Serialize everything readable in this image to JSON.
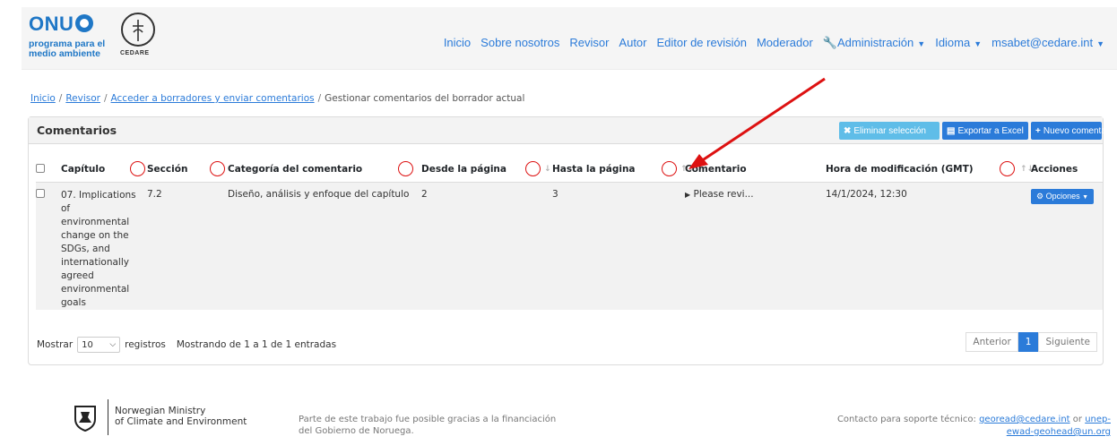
{
  "brand": {
    "onu": "ONU",
    "onu_sub": "programa para el medio ambiente",
    "cedare": "CEDARE"
  },
  "nav": {
    "items": [
      "Inicio",
      "Sobre nosotros",
      "Revisor",
      "Autor",
      "Editor de revisión",
      "Moderador"
    ],
    "admin": "Administración",
    "language": "Idioma",
    "user": "msabet@cedare.int"
  },
  "breadcrumb": {
    "home": "Inicio",
    "reviewer": "Revisor",
    "drafts": "Acceder a borradores y enviar comentarios",
    "current": "Gestionar comentarios del borrador actual"
  },
  "card": {
    "title": "Comentarios",
    "delete_label": "Eliminar selección",
    "export_label": "Exportar a Excel",
    "new_label": "Nuevo comentario"
  },
  "table": {
    "headers": {
      "chapter": "Capítulo",
      "section": "Sección",
      "category": "Categoría del comentario",
      "from_page": "Desde la página",
      "to_page": "Hasta la página",
      "comment": "Comentario",
      "modified": "Hora de modificación (GMT)",
      "actions": "Acciones"
    },
    "rows": [
      {
        "chapter": "07. Implications of environmental change on the SDGs, and internationally agreed environmental goals",
        "section": "7.2",
        "category": "Diseño, análisis y enfoque del capítulo",
        "from_page": "2",
        "to_page": "3",
        "comment": "Please revi...",
        "modified": "14/1/2024, 12:30",
        "options_label": "Opciones"
      }
    ]
  },
  "footer_controls": {
    "show_label": "Mostrar",
    "page_size": "10",
    "records_label": "registros",
    "info": "Mostrando de 1 a 1 de 1 entradas",
    "prev": "Anterior",
    "page": "1",
    "next": "Siguiente"
  },
  "footer": {
    "ministry_line1": "Norwegian Ministry",
    "ministry_line2": "of Climate and Environment",
    "funding": "Parte de este trabajo fue posible gracias a la financiación del Gobierno de Noruega.",
    "support_prefix": "Contacto para soporte técnico:",
    "support_email1": "georead@cedare.int",
    "support_or": "or",
    "support_email2": "unep-ewad-geohead@un.org"
  },
  "colors": {
    "primary": "#2b7bd9",
    "info": "#5fbde8",
    "brand_blue": "#1f77c6",
    "annotation_red": "#dd1111"
  }
}
